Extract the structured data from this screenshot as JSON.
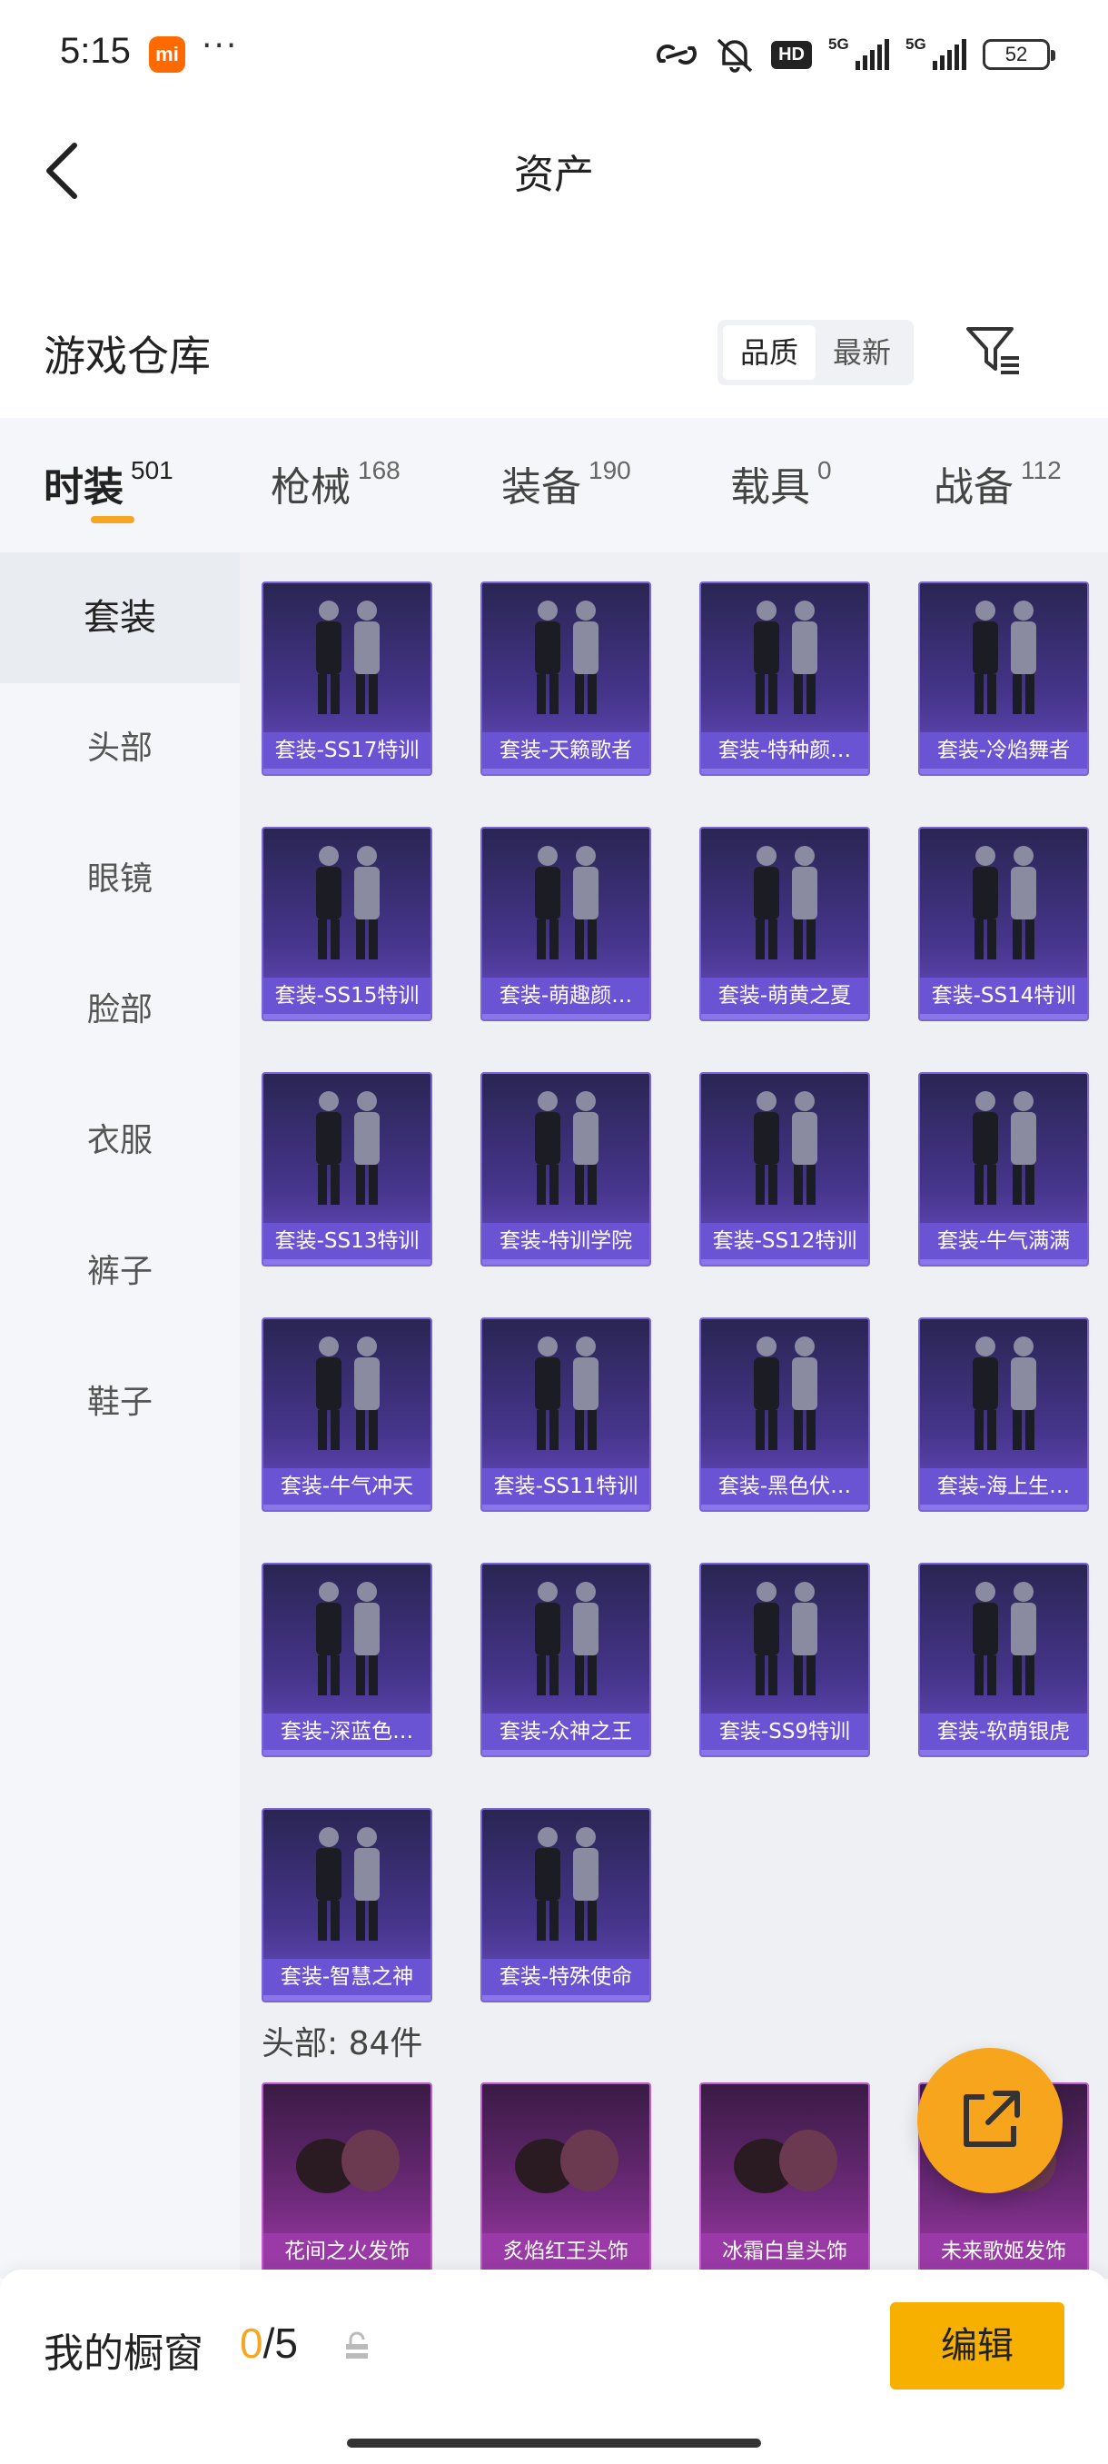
{
  "status_bar": {
    "time": "5:15",
    "app_badge": "mi",
    "more": "···",
    "hd": "HD",
    "signal1": "5G",
    "signal2": "5G",
    "battery": "52"
  },
  "header": {
    "title": "资产"
  },
  "warehouse": {
    "title": "游戏仓库",
    "sort_options": [
      "品质",
      "最新"
    ],
    "active_sort": "品质"
  },
  "tabs": [
    {
      "label": "时装",
      "count": "501",
      "active": true
    },
    {
      "label": "枪械",
      "count": "168"
    },
    {
      "label": "装备",
      "count": "190"
    },
    {
      "label": "载具",
      "count": "0"
    },
    {
      "label": "战备",
      "count": "112"
    }
  ],
  "sidebar": {
    "items": [
      "套装",
      "头部",
      "眼镜",
      "脸部",
      "衣服",
      "裤子",
      "鞋子"
    ],
    "active": "套装"
  },
  "suits": [
    {
      "name": "套装-SS17特训",
      "icon": "outfit-pair-red-black"
    },
    {
      "name": "套装-天籁歌者",
      "icon": "outfit-pair-white"
    },
    {
      "name": "套装-特种颜…",
      "icon": "outfit-green-yellow"
    },
    {
      "name": "套装-冷焰舞者",
      "icon": "outfit-pair-silver"
    },
    {
      "name": "套装-SS15特训",
      "icon": "outfit-black-tactical"
    },
    {
      "name": "套装-萌趣颜…",
      "icon": "outfit-green-mascot"
    },
    {
      "name": "套装-萌黄之夏",
      "icon": "outfit-pair-yellow"
    },
    {
      "name": "套装-SS14特训",
      "icon": "outfit-pair-black"
    },
    {
      "name": "套装-SS13特训",
      "icon": "outfit-pair-white-black"
    },
    {
      "name": "套装-特训学院",
      "icon": "outfit-school-uniform"
    },
    {
      "name": "套装-SS12特训",
      "icon": "outfit-pair-blue-camo"
    },
    {
      "name": "套装-牛气满满",
      "icon": "outfit-pair-red-white"
    },
    {
      "name": "套装-牛气冲天",
      "icon": "outfit-pair-red"
    },
    {
      "name": "套装-SS11特训",
      "icon": "outfit-teal"
    },
    {
      "name": "套装-黑色伏…",
      "icon": "outfit-black-hoodie"
    },
    {
      "name": "套装-海上生…",
      "icon": "outfit-blue-coat"
    },
    {
      "name": "套装-深蓝色…",
      "icon": "outfit-navy-suit"
    },
    {
      "name": "套装-众神之王",
      "icon": "outfit-pair-gold"
    },
    {
      "name": "套装-SS9特训",
      "icon": "outfit-denim"
    },
    {
      "name": "套装-软萌银虎",
      "icon": "outfit-pair-tiger"
    },
    {
      "name": "套装-智慧之神",
      "icon": "outfit-pair-purple"
    },
    {
      "name": "套装-特殊使命",
      "icon": "outfit-black-ops"
    }
  ],
  "head_section": {
    "label": "头部: 84件",
    "items": [
      {
        "name": "花间之火发饰",
        "icon": "hair-brown"
      },
      {
        "name": "炙焰红王头饰",
        "icon": "helmet-red"
      },
      {
        "name": "冰霜白皇头饰",
        "icon": "helmet-silver"
      },
      {
        "name": "未来歌姬发饰",
        "icon": "hair-purple"
      }
    ]
  },
  "fab": {
    "icon": "share-export-icon"
  },
  "bottom_bar": {
    "label": "我的橱窗",
    "current": "0",
    "separator": "/",
    "max": "5",
    "edit_label": "编辑"
  },
  "colors": {
    "accent": "#f5a623",
    "card_purple": "#6b54d4",
    "card_magenta": "#9a3aa6",
    "edit_button": "#f7b000"
  }
}
